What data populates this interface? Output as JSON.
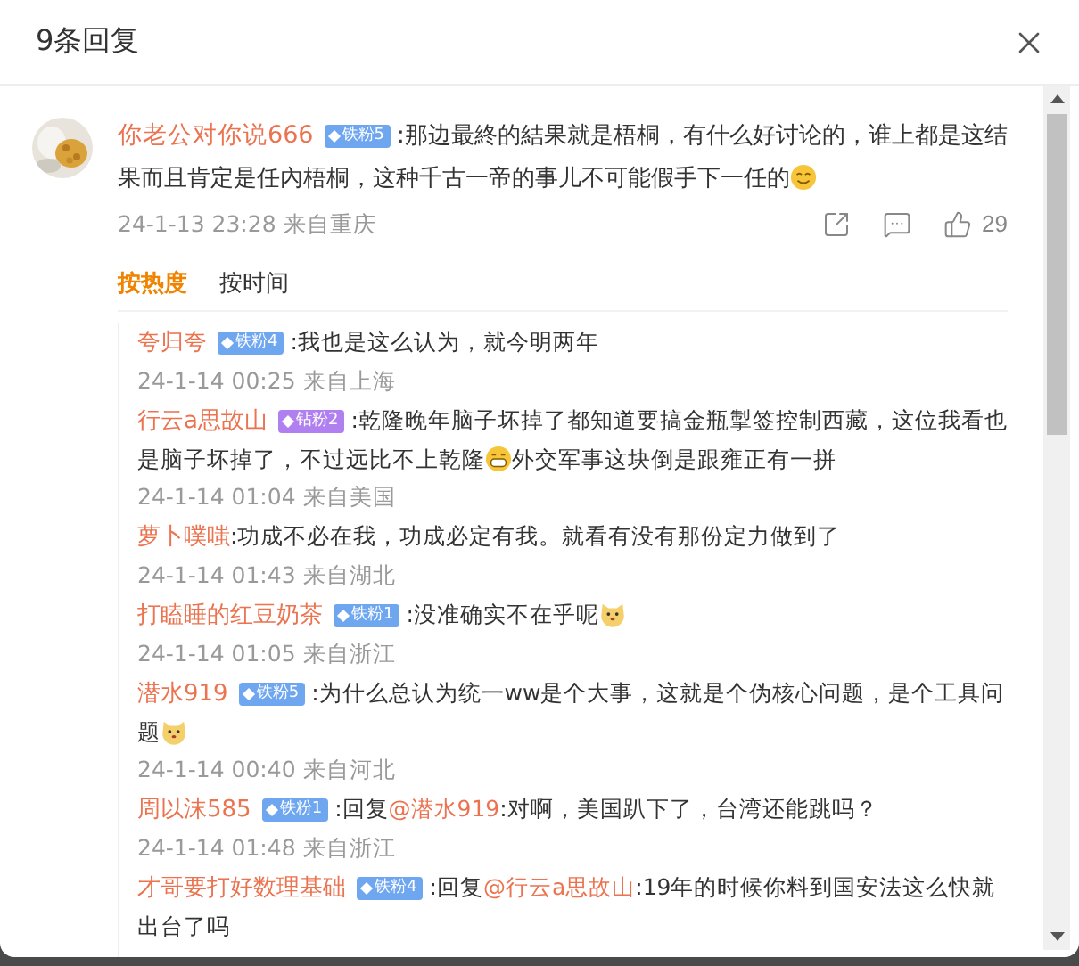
{
  "dialog": {
    "title": "9条回复"
  },
  "comment": {
    "author": "你老公对你说666",
    "badge": {
      "kind": "iron",
      "label": "铁粉5"
    },
    "content": [
      {
        "kind": "text",
        "text": ":那边最終的結果就是梧桐，有什么好讨论的，谁上都是这结果而且肯定是任內梧桐，这种千古一帝的事儿不可能假手下一任的"
      },
      {
        "kind": "smile"
      }
    ],
    "meta": "24-1-13 23:28 来自重庆",
    "likes": "29"
  },
  "sort_tabs": [
    {
      "label": "按热度",
      "selected": true
    },
    {
      "label": "按时间",
      "selected": false
    }
  ],
  "replies": [
    {
      "author": "夸归夸",
      "badge": {
        "kind": "iron",
        "label": "铁粉4"
      },
      "content": [
        {
          "kind": "text",
          "text": ":我也是这么认为，就今明两年"
        }
      ],
      "meta": "24-1-14 00:25 来自上海"
    },
    {
      "author": "行云a思故山",
      "badge": {
        "kind": "diamond",
        "label": "钻粉2"
      },
      "content": [
        {
          "kind": "text",
          "text": ":乾隆晚年脑子坏掉了都知道要搞金瓶掣签控制西藏，这位我看也是脑子坏掉了，不过远比不上乾隆"
        },
        {
          "kind": "grin"
        },
        {
          "kind": "text",
          "text": "外交军事这块倒是跟雍正有一拼"
        }
      ],
      "meta": "24-1-14 01:04 来自美国"
    },
    {
      "author": "萝卜噗嗤",
      "content": [
        {
          "kind": "text",
          "text": ":功成不必在我，功成必定有我。就看有没有那份定力做到了"
        }
      ],
      "meta": "24-1-14 01:43 来自湖北"
    },
    {
      "author": "打瞌睡的红豆奶茶",
      "badge": {
        "kind": "iron",
        "label": "铁粉1"
      },
      "content": [
        {
          "kind": "text",
          "text": ":没准确实不在乎呢"
        },
        {
          "kind": "dog"
        }
      ],
      "meta": "24-1-14 01:05 来自浙江"
    },
    {
      "author": "潜水919",
      "badge": {
        "kind": "iron",
        "label": "铁粉5"
      },
      "content": [
        {
          "kind": "text",
          "text": ":为什么总认为统一ww是个大事，这就是个伪核心问题，是个工具问题"
        },
        {
          "kind": "dog"
        }
      ],
      "meta": "24-1-14 00:40 来自河北"
    },
    {
      "author": "周以沫585",
      "badge": {
        "kind": "iron",
        "label": "铁粉1"
      },
      "content": [
        {
          "kind": "text",
          "text": ":回复"
        },
        {
          "kind": "mention",
          "text": "@潜水919"
        },
        {
          "kind": "text",
          "text": ":对啊，美国趴下了，台湾还能跳吗？"
        }
      ],
      "meta": "24-1-14 01:48 来自浙江"
    },
    {
      "author": "才哥要打好数理基础",
      "badge": {
        "kind": "iron",
        "label": "铁粉4"
      },
      "content": [
        {
          "kind": "text",
          "text": ":回复"
        },
        {
          "kind": "mention",
          "text": "@行云a思故山"
        },
        {
          "kind": "text",
          "text": ":19年的时候你料到国安法这么快就出台了吗"
        }
      ]
    }
  ]
}
